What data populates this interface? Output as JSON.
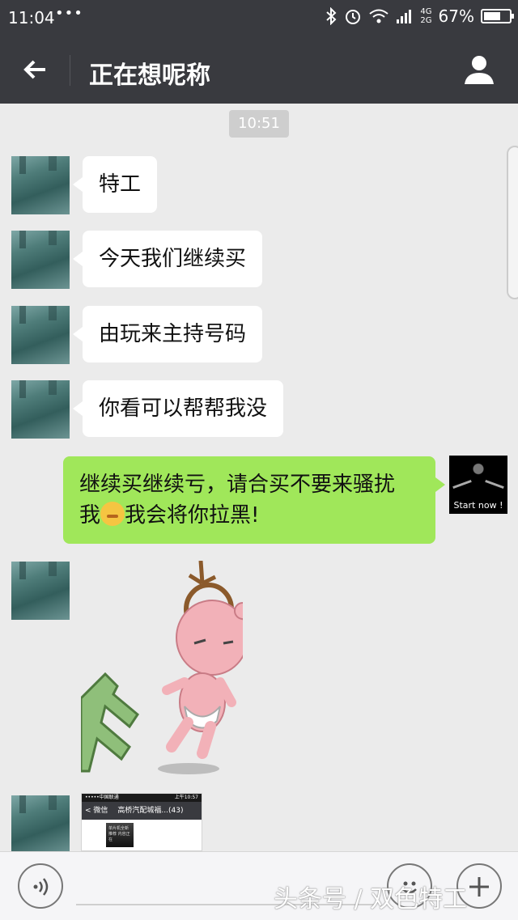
{
  "status_bar": {
    "time": "11:04",
    "dots": "•••",
    "network_top": "4G",
    "network_bottom": "2G",
    "battery_percent": "67%",
    "battery_level": 0.67
  },
  "header": {
    "title": "正在想呢称"
  },
  "chat": {
    "timestamp": "10:51",
    "received": [
      {
        "text": "特工"
      },
      {
        "text": "今天我们继续买"
      },
      {
        "text": "由玩来主持号码"
      },
      {
        "text": "你看可以帮帮我没"
      }
    ],
    "sent": {
      "line1": "继续买继续亏，请合买不要来骚扰",
      "line2_before": "我",
      "line2_after": "我会将你拉黑!",
      "emoji_icon": "thinking-face-icon"
    },
    "my_avatar_caption": "Start now !",
    "screenshot_thumb": {
      "carrier": "•••••中国联通",
      "clock": "上午10:57",
      "back": "< 微信",
      "group_title": "高桥汽配城福...(43)",
      "poster_text": "单片机全新推荐 内容正在"
    }
  },
  "input_bar": {
    "voice_icon": "voice-icon",
    "emoji_icon": "smile-icon",
    "plus_icon": "plus-icon"
  },
  "watermark": "头条号 / 双色特工",
  "colors": {
    "header_bg": "#393a3f",
    "chat_bg": "#ebebeb",
    "sent_bubble": "#a0e75a",
    "received_bubble": "#ffffff"
  }
}
